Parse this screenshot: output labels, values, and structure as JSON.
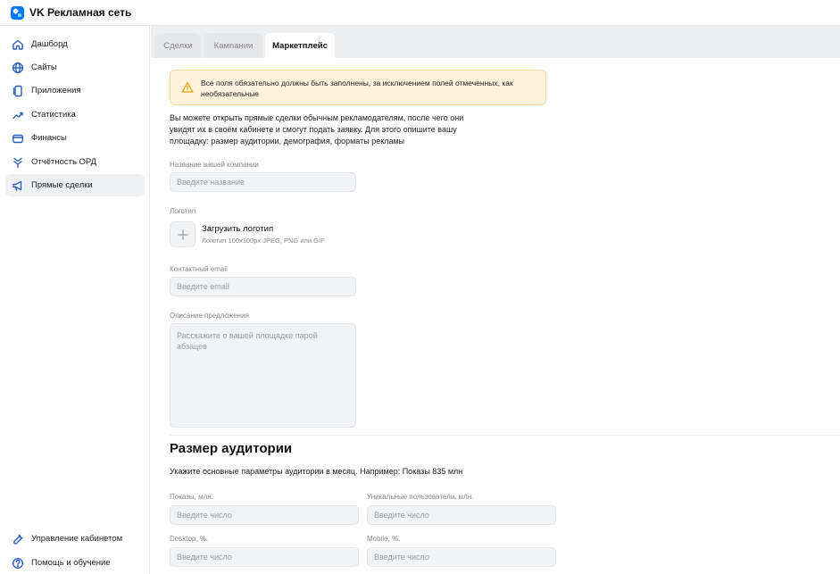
{
  "app": {
    "title": "VK Рекламная сеть",
    "logo_icon": "vk-ads-logo"
  },
  "sidebar": {
    "items": [
      {
        "label": "Дашборд",
        "icon": "home-icon"
      },
      {
        "label": "Сайты",
        "icon": "globe-icon"
      },
      {
        "label": "Приложения",
        "icon": "apps-icon"
      },
      {
        "label": "Статистика",
        "icon": "chart-icon"
      },
      {
        "label": "Финансы",
        "icon": "wallet-icon"
      },
      {
        "label": "Отчётность ОРД",
        "icon": "report-icon"
      },
      {
        "label": "Прямые сделки",
        "icon": "megaphone-icon",
        "active": true
      }
    ],
    "bottom": [
      {
        "label": "Управление кабинетом",
        "icon": "wrench-icon"
      },
      {
        "label": "Помощь и обучение",
        "icon": "help-icon"
      }
    ]
  },
  "tabs": [
    {
      "label": "Сделки"
    },
    {
      "label": "Кампании"
    },
    {
      "label": "Маркетплейс",
      "active": true
    }
  ],
  "notice": {
    "text": "Все поля обязательно должны быть заполнены, за исключением полей отмеченных, как необязательные"
  },
  "intro": "Вы можете открыть прямые сделки обычным рекламодателям, после чего они увидят их в своём кабинете и смогут подать заявку. Для этого опишите вашу площадку: размер аудитории, демография, форматы рекламы",
  "form": {
    "company": {
      "label": "Название вашей компании",
      "placeholder": "Введите название",
      "value": ""
    },
    "logo": {
      "label": "Логотип",
      "upload_title": "Загрузить логотип",
      "upload_hint": "Логотип 100х100px JPEG, PNG или GIF"
    },
    "email": {
      "label": "Контактный email",
      "placeholder": "Введите email",
      "value": ""
    },
    "description": {
      "label": "Описание предложения",
      "placeholder": "Расскажите о вашей площадке парой абзацев",
      "value": ""
    }
  },
  "audience": {
    "title": "Размер аудитории",
    "description": "Укажите основные параметры аудитории в месяц.  Например: Показы 835 млн",
    "fields": {
      "impressions": {
        "label": "Показы, млн.",
        "placeholder": "Введите число"
      },
      "unique_users": {
        "label": "Уникальные пользователи, млн.",
        "placeholder": "Введите число"
      },
      "desktop": {
        "label": "Desktop, %.",
        "placeholder": "Введите число"
      },
      "mobile": {
        "label": "Mobile, %.",
        "placeholder": "Введите число"
      }
    }
  },
  "colors": {
    "accent": "#0077ff",
    "icon": "#2c5fb8",
    "warning_bg": "#fdf2dc",
    "warning_icon": "#e8a317"
  }
}
